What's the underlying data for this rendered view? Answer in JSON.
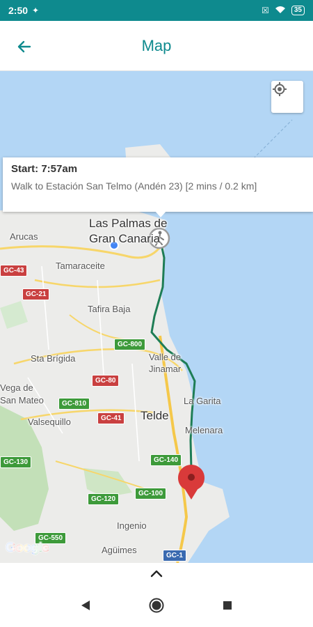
{
  "status_bar": {
    "time": "2:50",
    "battery": "35"
  },
  "app_bar": {
    "title": "Map"
  },
  "info_card": {
    "title": "Start: 7:57am",
    "description": "Walk to Estación San Telmo (Andén 23) [2 mins / 0.2 km]"
  },
  "map": {
    "places": {
      "las_palmas_1": "Las Palmas de",
      "las_palmas_2": "Gran Canaria",
      "arucas": "Arucas",
      "tamaraceite": "Tamaraceite",
      "tafira_baja": "Tafira Baja",
      "sta_brigida": "Sta Brígida",
      "valle_1": "Valle de",
      "valle_2": "Jinamar",
      "vega_1": "Vega de",
      "vega_2": "San Mateo",
      "valsequillo": "Valsequillo",
      "telde": "Telde",
      "la_garita": "La Garita",
      "melenara": "Melenara",
      "ingenio": "Ingenio",
      "aguimes": "Agüimes"
    },
    "roads": {
      "gc43": "GC-43",
      "gc21": "GC-21",
      "gc800": "GC-800",
      "gc80": "GC-80",
      "gc810": "GC-810",
      "gc41": "GC-41",
      "gc140": "GC-140",
      "gc130": "GC-130",
      "gc100": "GC-100",
      "gc120": "GC-120",
      "gc550": "GC-550",
      "gc1": "GC-1"
    },
    "attribution": "Google"
  },
  "colors": {
    "primary": "#0e8a8e",
    "route": "#1e7d55",
    "water": "#b3d6f5",
    "land": "#ececea",
    "marker": "#d93a3a"
  },
  "icons": {
    "back": "arrow-left-icon",
    "locate": "my-location-icon",
    "start_marker": "walking-person-icon",
    "end_marker": "map-pin-icon",
    "expand": "chevron-up-icon"
  }
}
